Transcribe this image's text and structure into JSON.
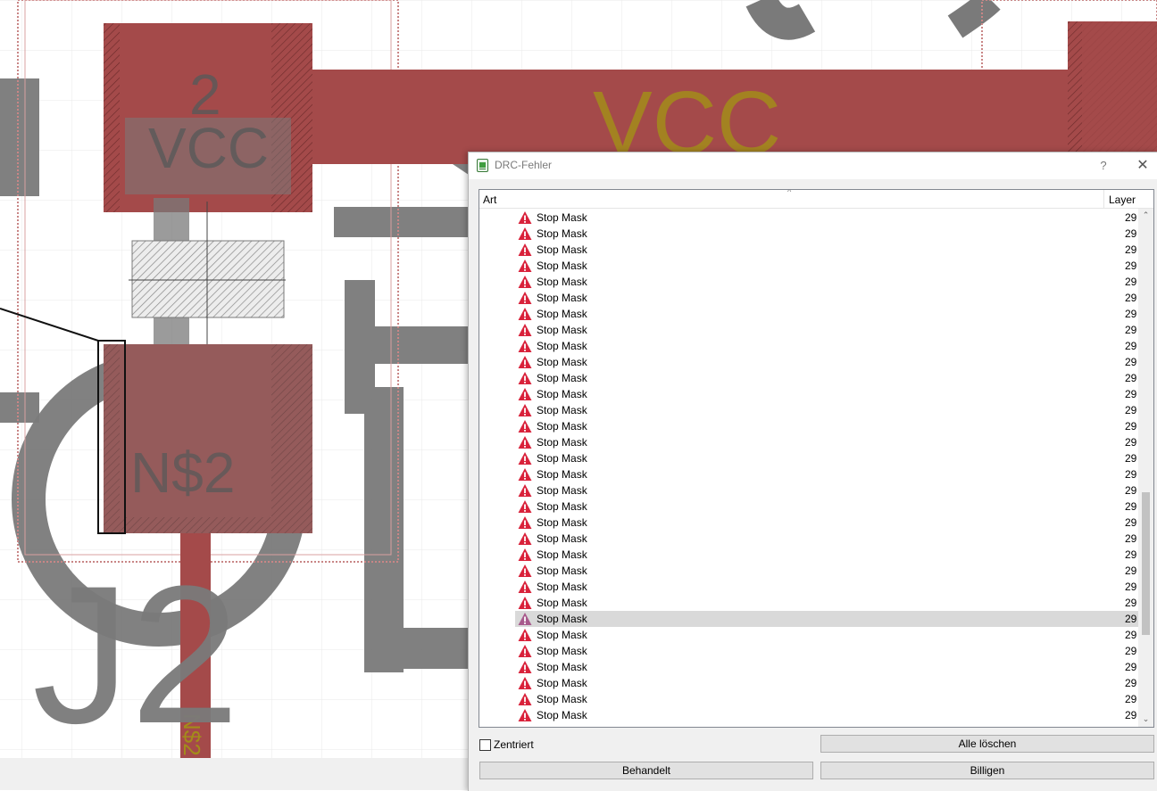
{
  "canvas": {
    "labels": {
      "pad_number": "2",
      "pad_net_top": "VCC",
      "trace_net": "VCC",
      "pad_net_bottom": "N$2",
      "part_name": "J2",
      "trace_label": "N$2"
    },
    "colors": {
      "background": "#ffffff",
      "grid": "#e8e8e8",
      "copper": "#a44a4a",
      "silk": "#7a7a7a",
      "net_name": "#a38c1a"
    }
  },
  "dialog": {
    "title": "DRC-Fehler",
    "help_label": "?",
    "close_label": "✕",
    "columns": {
      "art": "Art",
      "layer": "Layer"
    },
    "rows": [
      {
        "label": "Stop Mask",
        "layer": "29"
      },
      {
        "label": "Stop Mask",
        "layer": "29"
      },
      {
        "label": "Stop Mask",
        "layer": "29"
      },
      {
        "label": "Stop Mask",
        "layer": "29"
      },
      {
        "label": "Stop Mask",
        "layer": "29"
      },
      {
        "label": "Stop Mask",
        "layer": "29"
      },
      {
        "label": "Stop Mask",
        "layer": "29"
      },
      {
        "label": "Stop Mask",
        "layer": "29"
      },
      {
        "label": "Stop Mask",
        "layer": "29"
      },
      {
        "label": "Stop Mask",
        "layer": "29"
      },
      {
        "label": "Stop Mask",
        "layer": "29"
      },
      {
        "label": "Stop Mask",
        "layer": "29"
      },
      {
        "label": "Stop Mask",
        "layer": "29"
      },
      {
        "label": "Stop Mask",
        "layer": "29"
      },
      {
        "label": "Stop Mask",
        "layer": "29"
      },
      {
        "label": "Stop Mask",
        "layer": "29"
      },
      {
        "label": "Stop Mask",
        "layer": "29"
      },
      {
        "label": "Stop Mask",
        "layer": "29"
      },
      {
        "label": "Stop Mask",
        "layer": "29"
      },
      {
        "label": "Stop Mask",
        "layer": "29"
      },
      {
        "label": "Stop Mask",
        "layer": "29"
      },
      {
        "label": "Stop Mask",
        "layer": "29"
      },
      {
        "label": "Stop Mask",
        "layer": "29"
      },
      {
        "label": "Stop Mask",
        "layer": "29"
      },
      {
        "label": "Stop Mask",
        "layer": "29"
      },
      {
        "label": "Stop Mask",
        "layer": "29",
        "selected": true
      },
      {
        "label": "Stop Mask",
        "layer": "29"
      },
      {
        "label": "Stop Mask",
        "layer": "29"
      },
      {
        "label": "Stop Mask",
        "layer": "29"
      },
      {
        "label": "Stop Mask",
        "layer": "29"
      },
      {
        "label": "Stop Mask",
        "layer": "29"
      },
      {
        "label": "Stop Mask",
        "layer": "29"
      }
    ],
    "centered_label": "Zentriert",
    "centered_checked": false,
    "buttons": {
      "clear_all": "Alle löschen",
      "handled": "Behandelt",
      "approve": "Billigen"
    },
    "colors": {
      "warning": "#d9223b",
      "selection": "#d9d9d9"
    }
  }
}
